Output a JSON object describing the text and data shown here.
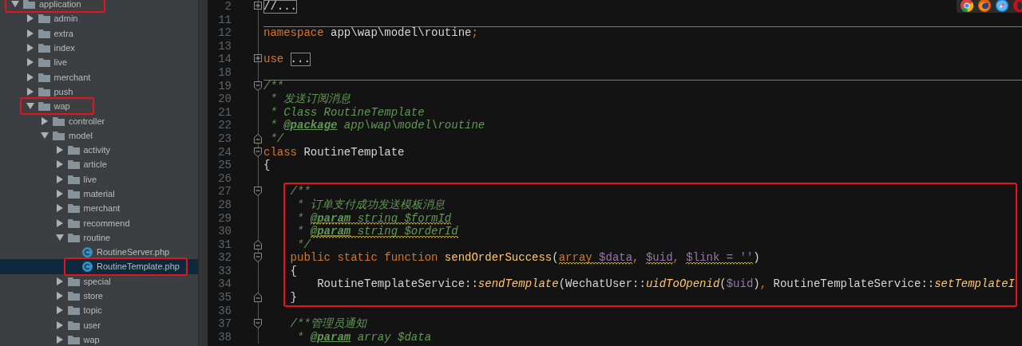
{
  "project_tree": [
    {
      "label": "application",
      "kind": "folder",
      "expanded": true,
      "selected": false,
      "annotated": true,
      "children": [
        {
          "label": "admin",
          "kind": "folder",
          "expanded": false,
          "selected": false,
          "annotated": false
        },
        {
          "label": "extra",
          "kind": "folder",
          "expanded": false,
          "selected": false,
          "annotated": false
        },
        {
          "label": "index",
          "kind": "folder",
          "expanded": false,
          "selected": false,
          "annotated": false
        },
        {
          "label": "live",
          "kind": "folder",
          "expanded": false,
          "selected": false,
          "annotated": false
        },
        {
          "label": "merchant",
          "kind": "folder",
          "expanded": false,
          "selected": false,
          "annotated": false
        },
        {
          "label": "push",
          "kind": "folder",
          "expanded": false,
          "selected": false,
          "annotated": false
        },
        {
          "label": "wap",
          "kind": "folder",
          "expanded": true,
          "selected": false,
          "annotated": true,
          "children": [
            {
              "label": "controller",
              "kind": "folder",
              "expanded": false,
              "selected": false,
              "annotated": false
            },
            {
              "label": "model",
              "kind": "folder",
              "expanded": true,
              "selected": false,
              "annotated": false,
              "children": [
                {
                  "label": "activity",
                  "kind": "folder",
                  "expanded": false,
                  "selected": false,
                  "annotated": false
                },
                {
                  "label": "article",
                  "kind": "folder",
                  "expanded": false,
                  "selected": false,
                  "annotated": false
                },
                {
                  "label": "live",
                  "kind": "folder",
                  "expanded": false,
                  "selected": false,
                  "annotated": false
                },
                {
                  "label": "material",
                  "kind": "folder",
                  "expanded": false,
                  "selected": false,
                  "annotated": false
                },
                {
                  "label": "merchant",
                  "kind": "folder",
                  "expanded": false,
                  "selected": false,
                  "annotated": false
                },
                {
                  "label": "recommend",
                  "kind": "folder",
                  "expanded": false,
                  "selected": false,
                  "annotated": false
                },
                {
                  "label": "routine",
                  "kind": "folder",
                  "expanded": true,
                  "selected": false,
                  "annotated": false,
                  "children": [
                    {
                      "label": "RoutineServer.php",
                      "kind": "class",
                      "selected": false,
                      "annotated": false
                    },
                    {
                      "label": "RoutineTemplate.php",
                      "kind": "class",
                      "selected": true,
                      "annotated": true
                    }
                  ]
                },
                {
                  "label": "special",
                  "kind": "folder",
                  "expanded": false,
                  "selected": false,
                  "annotated": false
                },
                {
                  "label": "store",
                  "kind": "folder",
                  "expanded": false,
                  "selected": false,
                  "annotated": false
                },
                {
                  "label": "topic",
                  "kind": "folder",
                  "expanded": false,
                  "selected": false,
                  "annotated": false
                },
                {
                  "label": "user",
                  "kind": "folder",
                  "expanded": false,
                  "selected": false,
                  "annotated": false
                },
                {
                  "label": "wap",
                  "kind": "folder",
                  "expanded": false,
                  "selected": false,
                  "annotated": false
                }
              ]
            }
          ]
        }
      ]
    }
  ],
  "editor": {
    "blocks": [
      {
        "annotated": false,
        "lines": [
          {
            "number": "2",
            "fold_marker": {
              "kind": "collapsed"
            },
            "tokens": [
              {
                "text": "//...",
                "kind": "folded"
              }
            ]
          },
          {
            "number": "11"
          },
          {
            "number": "12",
            "separator_above": true,
            "tokens": [
              {
                "text": "namespace",
                "kind": "keyword"
              },
              {
                "text": " app\\wap\\model\\routine",
                "kind": "plain"
              },
              {
                "text": ";",
                "kind": "keyword"
              }
            ]
          },
          {
            "number": "13"
          },
          {
            "number": "14",
            "fold_marker": {
              "kind": "collapsed"
            },
            "tokens": [
              {
                "text": "use ",
                "kind": "keyword"
              },
              {
                "text": "...",
                "kind": "folded"
              }
            ]
          },
          {
            "number": "18"
          },
          {
            "number": "19",
            "fold_marker": {
              "kind": "start"
            },
            "separator_above": true,
            "tokens": [
              {
                "text": "/**",
                "kind": "comment"
              }
            ]
          },
          {
            "number": "20",
            "tokens": [
              {
                "text": " * 发送订阅消息",
                "kind": "comment"
              }
            ]
          },
          {
            "number": "21",
            "tokens": [
              {
                "text": " * Class RoutineTemplate",
                "kind": "comment"
              }
            ]
          },
          {
            "number": "22",
            "tokens": [
              {
                "text": " * ",
                "kind": "comment"
              },
              {
                "text": "@package",
                "kind": "doctag"
              },
              {
                "text": " app\\wap\\model\\routine",
                "kind": "comment"
              }
            ]
          },
          {
            "number": "23",
            "fold_marker": {
              "kind": "end"
            },
            "tokens": [
              {
                "text": " */",
                "kind": "comment"
              }
            ]
          },
          {
            "number": "24",
            "fold_marker": {
              "kind": "start"
            },
            "tokens": [
              {
                "text": "class",
                "kind": "keyword"
              },
              {
                "text": " RoutineTemplate",
                "kind": "plain"
              }
            ]
          },
          {
            "number": "25",
            "tokens": [
              {
                "text": "{",
                "kind": "plain"
              }
            ]
          },
          {
            "number": "26"
          }
        ]
      },
      {
        "annotated": true,
        "lines": [
          {
            "number": "27",
            "fold_marker": {
              "kind": "start"
            },
            "tokens": [
              {
                "text": "    /**",
                "kind": "comment"
              }
            ]
          },
          {
            "number": "28",
            "tokens": [
              {
                "text": "     * 订单支付成功发送模板消息",
                "kind": "comment"
              }
            ]
          },
          {
            "number": "29",
            "tokens": [
              {
                "text": "     * ",
                "kind": "comment"
              },
              {
                "text": "@param string $formId",
                "kind": "doctag",
                "warning": true
              }
            ]
          },
          {
            "number": "30",
            "tokens": [
              {
                "text": "     * ",
                "kind": "comment"
              },
              {
                "text": "@param string $orderId",
                "kind": "doctag",
                "warning": true
              }
            ]
          },
          {
            "number": "31",
            "fold_marker": {
              "kind": "end"
            },
            "tokens": [
              {
                "text": "     */",
                "kind": "comment"
              }
            ]
          },
          {
            "number": "32",
            "fold_marker": {
              "kind": "start"
            },
            "tokens": [
              {
                "text": "    public static function ",
                "kind": "keyword"
              },
              {
                "text": "sendOrderSuccess",
                "kind": "function"
              },
              {
                "text": "(",
                "kind": "plain"
              },
              {
                "text": "array $data",
                "kind": "typed-variable",
                "warning": true
              },
              {
                "text": ", ",
                "kind": "keyword"
              },
              {
                "text": "$uid",
                "kind": "variable",
                "warning": true
              },
              {
                "text": ", ",
                "kind": "keyword"
              },
              {
                "text": "$link = ''",
                "kind": "variable",
                "warning": true
              },
              {
                "text": ")",
                "kind": "plain"
              }
            ]
          },
          {
            "number": "33",
            "tokens": [
              {
                "text": "    {",
                "kind": "plain"
              }
            ]
          },
          {
            "number": "34",
            "tokens": [
              {
                "text": "        RoutineTemplateService::",
                "kind": "plain"
              },
              {
                "text": "sendTemplate",
                "kind": "static-call"
              },
              {
                "text": "(WechatUser::",
                "kind": "plain"
              },
              {
                "text": "uidToOpenid",
                "kind": "static-call"
              },
              {
                "text": "(",
                "kind": "plain"
              },
              {
                "text": "$uid",
                "kind": "variable"
              },
              {
                "text": ")",
                "kind": "plain"
              },
              {
                "text": ", ",
                "kind": "keyword"
              },
              {
                "text": "RoutineTemplateService::",
                "kind": "plain"
              },
              {
                "text": "setTemplateI",
                "kind": "static-call"
              }
            ]
          },
          {
            "number": "35",
            "fold_marker": {
              "kind": "end"
            },
            "tokens": [
              {
                "text": "    }",
                "kind": "plain"
              }
            ]
          }
        ]
      },
      {
        "annotated": false,
        "lines": [
          {
            "number": "36"
          },
          {
            "number": "37",
            "fold_marker": {
              "kind": "start"
            },
            "tokens": [
              {
                "text": "    /**管理员通知",
                "kind": "comment"
              }
            ]
          },
          {
            "number": "38",
            "tokens": [
              {
                "text": "     * ",
                "kind": "comment"
              },
              {
                "text": "@param",
                "kind": "doctag"
              },
              {
                "text": " array $data",
                "kind": "comment"
              }
            ]
          }
        ]
      }
    ]
  },
  "browser_icons": [
    {
      "kind": "chrome"
    },
    {
      "kind": "firefox"
    },
    {
      "kind": "safari"
    },
    {
      "kind": "opera"
    }
  ]
}
